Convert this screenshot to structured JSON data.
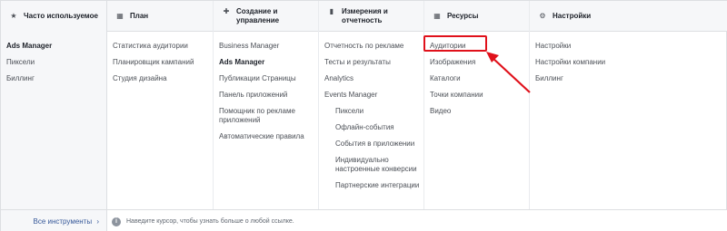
{
  "columns": [
    {
      "title": "Часто используемое",
      "icon": "star-icon",
      "items": [
        {
          "label": "Ads Manager",
          "bold": true
        },
        {
          "label": "Пиксели"
        },
        {
          "label": "Биллинг"
        }
      ]
    },
    {
      "title": "План",
      "icon": "grid-icon",
      "items": [
        {
          "label": "Статистика аудитории"
        },
        {
          "label": "Планировщик кампаний"
        },
        {
          "label": "Студия дизайна"
        }
      ]
    },
    {
      "title": "Создание и управление",
      "icon": "plus-icon",
      "items": [
        {
          "label": "Business Manager"
        },
        {
          "label": "Ads Manager",
          "bold": true
        },
        {
          "label": "Публикации Страницы"
        },
        {
          "label": "Панель приложений"
        },
        {
          "label": "Помощник по рекламе приложений"
        },
        {
          "label": "Автоматические правила"
        }
      ]
    },
    {
      "title": "Измерения и отчетность",
      "icon": "bar-chart-icon",
      "items": [
        {
          "label": "Отчетность по рекламе"
        },
        {
          "label": "Тесты и результаты"
        },
        {
          "label": "Analytics"
        },
        {
          "label": "Events Manager"
        },
        {
          "label": "Пиксели",
          "sub": true
        },
        {
          "label": "Офлайн-события",
          "sub": true
        },
        {
          "label": "События в приложении",
          "sub": true
        },
        {
          "label": "Индивидуально настроенные конверсии",
          "sub": true
        },
        {
          "label": "Партнерские интеграции",
          "sub": true
        }
      ]
    },
    {
      "title": "Ресурсы",
      "icon": "grid-icon",
      "items": [
        {
          "label": "Аудитории"
        },
        {
          "label": "Изображения"
        },
        {
          "label": "Каталоги"
        },
        {
          "label": "Точки компании"
        },
        {
          "label": "Видео"
        }
      ]
    },
    {
      "title": "Настройки",
      "icon": "gear-icon",
      "items": [
        {
          "label": "Настройки"
        },
        {
          "label": "Настройки компании"
        },
        {
          "label": "Биллинг"
        }
      ]
    }
  ],
  "footer": {
    "all_tools": "Все инструменты",
    "chevron": "›",
    "info_glyph": "i",
    "hint": "Наведите курсор, чтобы узнать больше о любой ссылке."
  },
  "annotation_color": "#e0111b"
}
